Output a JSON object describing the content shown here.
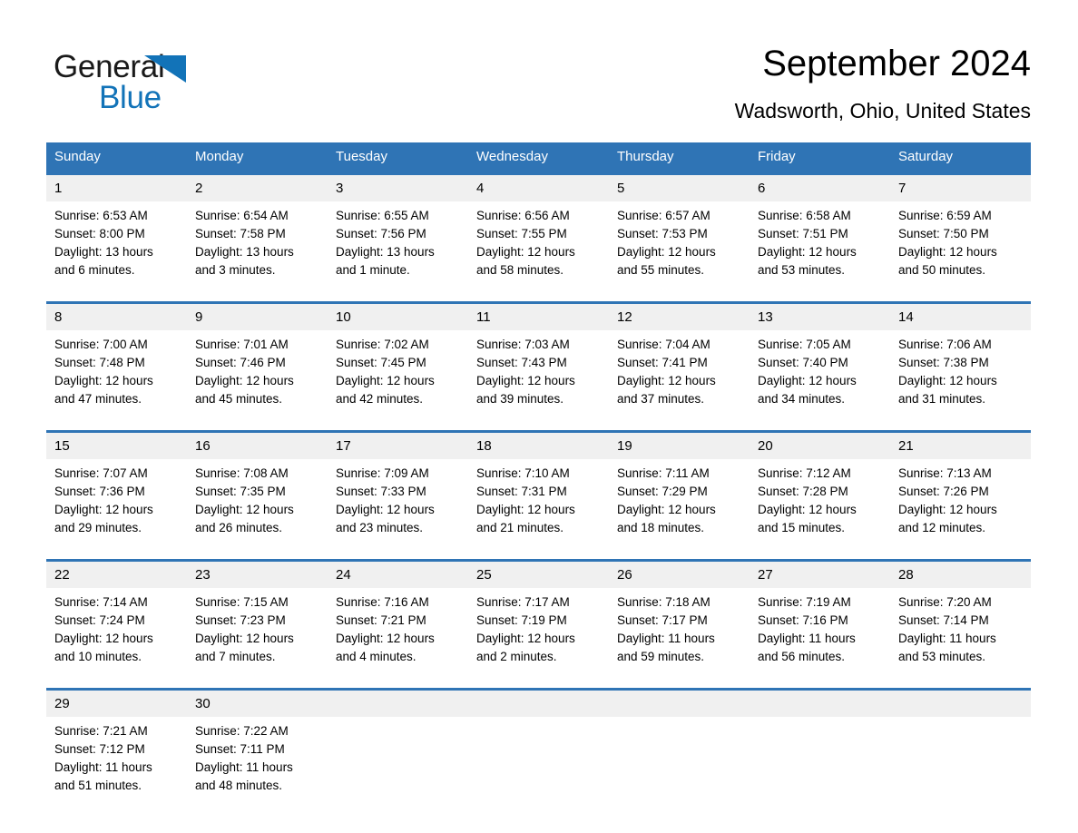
{
  "brand": {
    "name_part1": "General",
    "name_part2": "Blue",
    "triangle_color": "#1273b8",
    "logo_icon": "triangle-logo-icon"
  },
  "header": {
    "month_title": "September 2024",
    "location": "Wadsworth, Ohio, United States"
  },
  "theme": {
    "header_blue": "#2f74b5",
    "row_divider_blue": "#2f74b5",
    "daynum_background": "#f0f0f0",
    "page_background": "#ffffff",
    "text_color": "#000000"
  },
  "calendar": {
    "weekday_headers": [
      "Sunday",
      "Monday",
      "Tuesday",
      "Wednesday",
      "Thursday",
      "Friday",
      "Saturday"
    ],
    "weeks": [
      [
        {
          "day": "1",
          "sunrise": "Sunrise: 6:53 AM",
          "sunset": "Sunset: 8:00 PM",
          "daylight_line1": "Daylight: 13 hours",
          "daylight_line2": "and 6 minutes."
        },
        {
          "day": "2",
          "sunrise": "Sunrise: 6:54 AM",
          "sunset": "Sunset: 7:58 PM",
          "daylight_line1": "Daylight: 13 hours",
          "daylight_line2": "and 3 minutes."
        },
        {
          "day": "3",
          "sunrise": "Sunrise: 6:55 AM",
          "sunset": "Sunset: 7:56 PM",
          "daylight_line1": "Daylight: 13 hours",
          "daylight_line2": "and 1 minute."
        },
        {
          "day": "4",
          "sunrise": "Sunrise: 6:56 AM",
          "sunset": "Sunset: 7:55 PM",
          "daylight_line1": "Daylight: 12 hours",
          "daylight_line2": "and 58 minutes."
        },
        {
          "day": "5",
          "sunrise": "Sunrise: 6:57 AM",
          "sunset": "Sunset: 7:53 PM",
          "daylight_line1": "Daylight: 12 hours",
          "daylight_line2": "and 55 minutes."
        },
        {
          "day": "6",
          "sunrise": "Sunrise: 6:58 AM",
          "sunset": "Sunset: 7:51 PM",
          "daylight_line1": "Daylight: 12 hours",
          "daylight_line2": "and 53 minutes."
        },
        {
          "day": "7",
          "sunrise": "Sunrise: 6:59 AM",
          "sunset": "Sunset: 7:50 PM",
          "daylight_line1": "Daylight: 12 hours",
          "daylight_line2": "and 50 minutes."
        }
      ],
      [
        {
          "day": "8",
          "sunrise": "Sunrise: 7:00 AM",
          "sunset": "Sunset: 7:48 PM",
          "daylight_line1": "Daylight: 12 hours",
          "daylight_line2": "and 47 minutes."
        },
        {
          "day": "9",
          "sunrise": "Sunrise: 7:01 AM",
          "sunset": "Sunset: 7:46 PM",
          "daylight_line1": "Daylight: 12 hours",
          "daylight_line2": "and 45 minutes."
        },
        {
          "day": "10",
          "sunrise": "Sunrise: 7:02 AM",
          "sunset": "Sunset: 7:45 PM",
          "daylight_line1": "Daylight: 12 hours",
          "daylight_line2": "and 42 minutes."
        },
        {
          "day": "11",
          "sunrise": "Sunrise: 7:03 AM",
          "sunset": "Sunset: 7:43 PM",
          "daylight_line1": "Daylight: 12 hours",
          "daylight_line2": "and 39 minutes."
        },
        {
          "day": "12",
          "sunrise": "Sunrise: 7:04 AM",
          "sunset": "Sunset: 7:41 PM",
          "daylight_line1": "Daylight: 12 hours",
          "daylight_line2": "and 37 minutes."
        },
        {
          "day": "13",
          "sunrise": "Sunrise: 7:05 AM",
          "sunset": "Sunset: 7:40 PM",
          "daylight_line1": "Daylight: 12 hours",
          "daylight_line2": "and 34 minutes."
        },
        {
          "day": "14",
          "sunrise": "Sunrise: 7:06 AM",
          "sunset": "Sunset: 7:38 PM",
          "daylight_line1": "Daylight: 12 hours",
          "daylight_line2": "and 31 minutes."
        }
      ],
      [
        {
          "day": "15",
          "sunrise": "Sunrise: 7:07 AM",
          "sunset": "Sunset: 7:36 PM",
          "daylight_line1": "Daylight: 12 hours",
          "daylight_line2": "and 29 minutes."
        },
        {
          "day": "16",
          "sunrise": "Sunrise: 7:08 AM",
          "sunset": "Sunset: 7:35 PM",
          "daylight_line1": "Daylight: 12 hours",
          "daylight_line2": "and 26 minutes."
        },
        {
          "day": "17",
          "sunrise": "Sunrise: 7:09 AM",
          "sunset": "Sunset: 7:33 PM",
          "daylight_line1": "Daylight: 12 hours",
          "daylight_line2": "and 23 minutes."
        },
        {
          "day": "18",
          "sunrise": "Sunrise: 7:10 AM",
          "sunset": "Sunset: 7:31 PM",
          "daylight_line1": "Daylight: 12 hours",
          "daylight_line2": "and 21 minutes."
        },
        {
          "day": "19",
          "sunrise": "Sunrise: 7:11 AM",
          "sunset": "Sunset: 7:29 PM",
          "daylight_line1": "Daylight: 12 hours",
          "daylight_line2": "and 18 minutes."
        },
        {
          "day": "20",
          "sunrise": "Sunrise: 7:12 AM",
          "sunset": "Sunset: 7:28 PM",
          "daylight_line1": "Daylight: 12 hours",
          "daylight_line2": "and 15 minutes."
        },
        {
          "day": "21",
          "sunrise": "Sunrise: 7:13 AM",
          "sunset": "Sunset: 7:26 PM",
          "daylight_line1": "Daylight: 12 hours",
          "daylight_line2": "and 12 minutes."
        }
      ],
      [
        {
          "day": "22",
          "sunrise": "Sunrise: 7:14 AM",
          "sunset": "Sunset: 7:24 PM",
          "daylight_line1": "Daylight: 12 hours",
          "daylight_line2": "and 10 minutes."
        },
        {
          "day": "23",
          "sunrise": "Sunrise: 7:15 AM",
          "sunset": "Sunset: 7:23 PM",
          "daylight_line1": "Daylight: 12 hours",
          "daylight_line2": "and 7 minutes."
        },
        {
          "day": "24",
          "sunrise": "Sunrise: 7:16 AM",
          "sunset": "Sunset: 7:21 PM",
          "daylight_line1": "Daylight: 12 hours",
          "daylight_line2": "and 4 minutes."
        },
        {
          "day": "25",
          "sunrise": "Sunrise: 7:17 AM",
          "sunset": "Sunset: 7:19 PM",
          "daylight_line1": "Daylight: 12 hours",
          "daylight_line2": "and 2 minutes."
        },
        {
          "day": "26",
          "sunrise": "Sunrise: 7:18 AM",
          "sunset": "Sunset: 7:17 PM",
          "daylight_line1": "Daylight: 11 hours",
          "daylight_line2": "and 59 minutes."
        },
        {
          "day": "27",
          "sunrise": "Sunrise: 7:19 AM",
          "sunset": "Sunset: 7:16 PM",
          "daylight_line1": "Daylight: 11 hours",
          "daylight_line2": "and 56 minutes."
        },
        {
          "day": "28",
          "sunrise": "Sunrise: 7:20 AM",
          "sunset": "Sunset: 7:14 PM",
          "daylight_line1": "Daylight: 11 hours",
          "daylight_line2": "and 53 minutes."
        }
      ],
      [
        {
          "day": "29",
          "sunrise": "Sunrise: 7:21 AM",
          "sunset": "Sunset: 7:12 PM",
          "daylight_line1": "Daylight: 11 hours",
          "daylight_line2": "and 51 minutes."
        },
        {
          "day": "30",
          "sunrise": "Sunrise: 7:22 AM",
          "sunset": "Sunset: 7:11 PM",
          "daylight_line1": "Daylight: 11 hours",
          "daylight_line2": "and 48 minutes."
        },
        {
          "day": "",
          "sunrise": "",
          "sunset": "",
          "daylight_line1": "",
          "daylight_line2": ""
        },
        {
          "day": "",
          "sunrise": "",
          "sunset": "",
          "daylight_line1": "",
          "daylight_line2": ""
        },
        {
          "day": "",
          "sunrise": "",
          "sunset": "",
          "daylight_line1": "",
          "daylight_line2": ""
        },
        {
          "day": "",
          "sunrise": "",
          "sunset": "",
          "daylight_line1": "",
          "daylight_line2": ""
        },
        {
          "day": "",
          "sunrise": "",
          "sunset": "",
          "daylight_line1": "",
          "daylight_line2": ""
        }
      ]
    ]
  }
}
